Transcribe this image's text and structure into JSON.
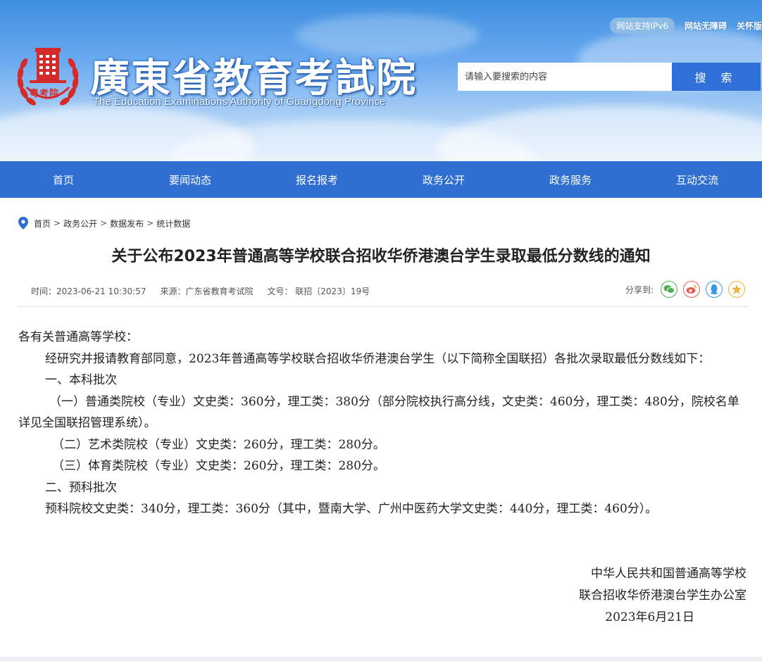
{
  "header": {
    "site_title": "廣東省教育考試院",
    "site_subtitle": "The Education Examinations Authority of Guangdong Province",
    "logo_text": "粤考院",
    "top_links": {
      "ipv6": "网站支持IPv6",
      "accessibility": "网站无障碍",
      "elderly": "关怀版"
    },
    "search": {
      "placeholder": "请输入要搜索的内容",
      "button_label": "搜 索"
    }
  },
  "nav": {
    "items": [
      {
        "label": "首页"
      },
      {
        "label": "要闻动态"
      },
      {
        "label": "报名报考"
      },
      {
        "label": "政务公开"
      },
      {
        "label": "政务服务"
      },
      {
        "label": "互动交流"
      }
    ]
  },
  "breadcrumb": {
    "items": [
      "首页",
      "政务公开",
      "数据发布",
      "统计数据"
    ],
    "separator": ">"
  },
  "article": {
    "title": "关于公布2023年普通高等学校联合招收华侨港澳台学生录取最低分数线的通知",
    "meta": {
      "time": "时间：2023-06-21 10:30:57",
      "source": "来源：广东省教育考试院",
      "doc_no": "文号： 联招〔2023〕19号"
    },
    "share_label": "分享到:",
    "share_icons": [
      "wechat-icon",
      "weibo-icon",
      "qq-icon",
      "qzone-icon"
    ],
    "share_colors": {
      "wechat": "#4caf50",
      "weibo": "#e85a4f",
      "qq": "#3a9ae0",
      "qzone": "#f0b43c"
    },
    "paragraphs": {
      "salutation": "各有关普通高等学校：",
      "intro": "经研究并报请教育部同意，2023年普通高等学校联合招收华侨港澳台学生（以下简称全国联招）各批次录取最低分数线如下：",
      "section1": "一、本科批次",
      "item1": "（一）普通类院校（专业）文史类：360分，理工类：380分（部分院校执行高分线，文史类：460分，理工类：480分，院校名单详见全国联招管理系统）。",
      "item2": "（二）艺术类院校（专业）文史类：260分，理工类：280分。",
      "item3": "（三）体育类院校（专业）文史类：260分，理工类：280分。",
      "section2": "二、预科批次",
      "item4": "预科院校文史类：340分，理工类：360分（其中，暨南大学、广州中医药大学文史类：440分，理工类：460分）。"
    },
    "signature": {
      "line1": "中华人民共和国普通高等学校",
      "line2": "联合招收华侨港澳台学生办公室",
      "date": "2023年6月21日"
    }
  },
  "colors": {
    "nav_blue": "#2e6fd1",
    "search_button": "#2f6fd8",
    "logo_red": "#d42a2a"
  }
}
